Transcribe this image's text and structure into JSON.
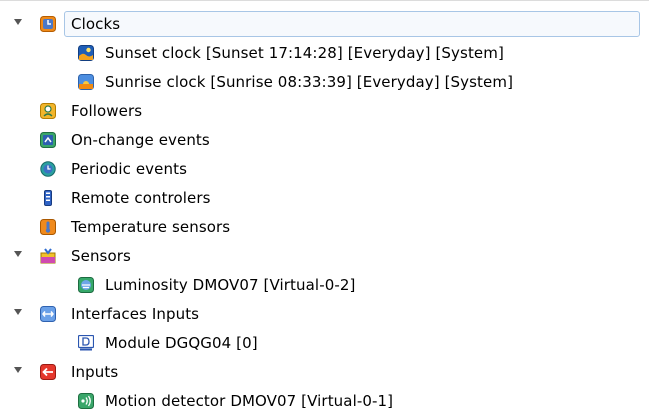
{
  "tree": {
    "clocks": {
      "label": "Clocks",
      "expanded": true,
      "selected": true,
      "icon": "clock-icon",
      "children": [
        {
          "label": "Sunset clock [Sunset 17:14:28] [Everyday] [System]",
          "icon": "sunset-icon"
        },
        {
          "label": "Sunrise clock [Sunrise 08:33:39] [Everyday] [System]",
          "icon": "sunrise-icon"
        }
      ]
    },
    "followers": {
      "label": "Followers",
      "icon": "follower-icon"
    },
    "on_change_events": {
      "label": "On-change events",
      "icon": "on-change-icon"
    },
    "periodic_events": {
      "label": "Periodic events",
      "icon": "periodic-icon"
    },
    "remote_controlers": {
      "label": "Remote controlers",
      "icon": "remote-icon"
    },
    "temperature_sensors": {
      "label": "Temperature sensors",
      "icon": "thermometer-icon"
    },
    "sensors": {
      "label": "Sensors",
      "expanded": true,
      "icon": "sensors-icon",
      "children": [
        {
          "label": "Luminosity DMOV07 [Virtual-0-2]",
          "icon": "luminosity-icon"
        }
      ]
    },
    "interfaces_inputs": {
      "label": "Interfaces Inputs",
      "expanded": true,
      "icon": "interfaces-icon",
      "children": [
        {
          "label": "Module DGQG04 [0]",
          "icon": "module-icon"
        }
      ]
    },
    "inputs": {
      "label": "Inputs",
      "expanded": true,
      "icon": "input-icon",
      "children": [
        {
          "label": "Motion detector DMOV07 [Virtual-0-1]",
          "icon": "motion-detector-icon"
        }
      ]
    }
  },
  "colors": {
    "selection_border": "#a8c6e6",
    "selection_fill": "#f6f9fd",
    "arrow": "#555555"
  }
}
